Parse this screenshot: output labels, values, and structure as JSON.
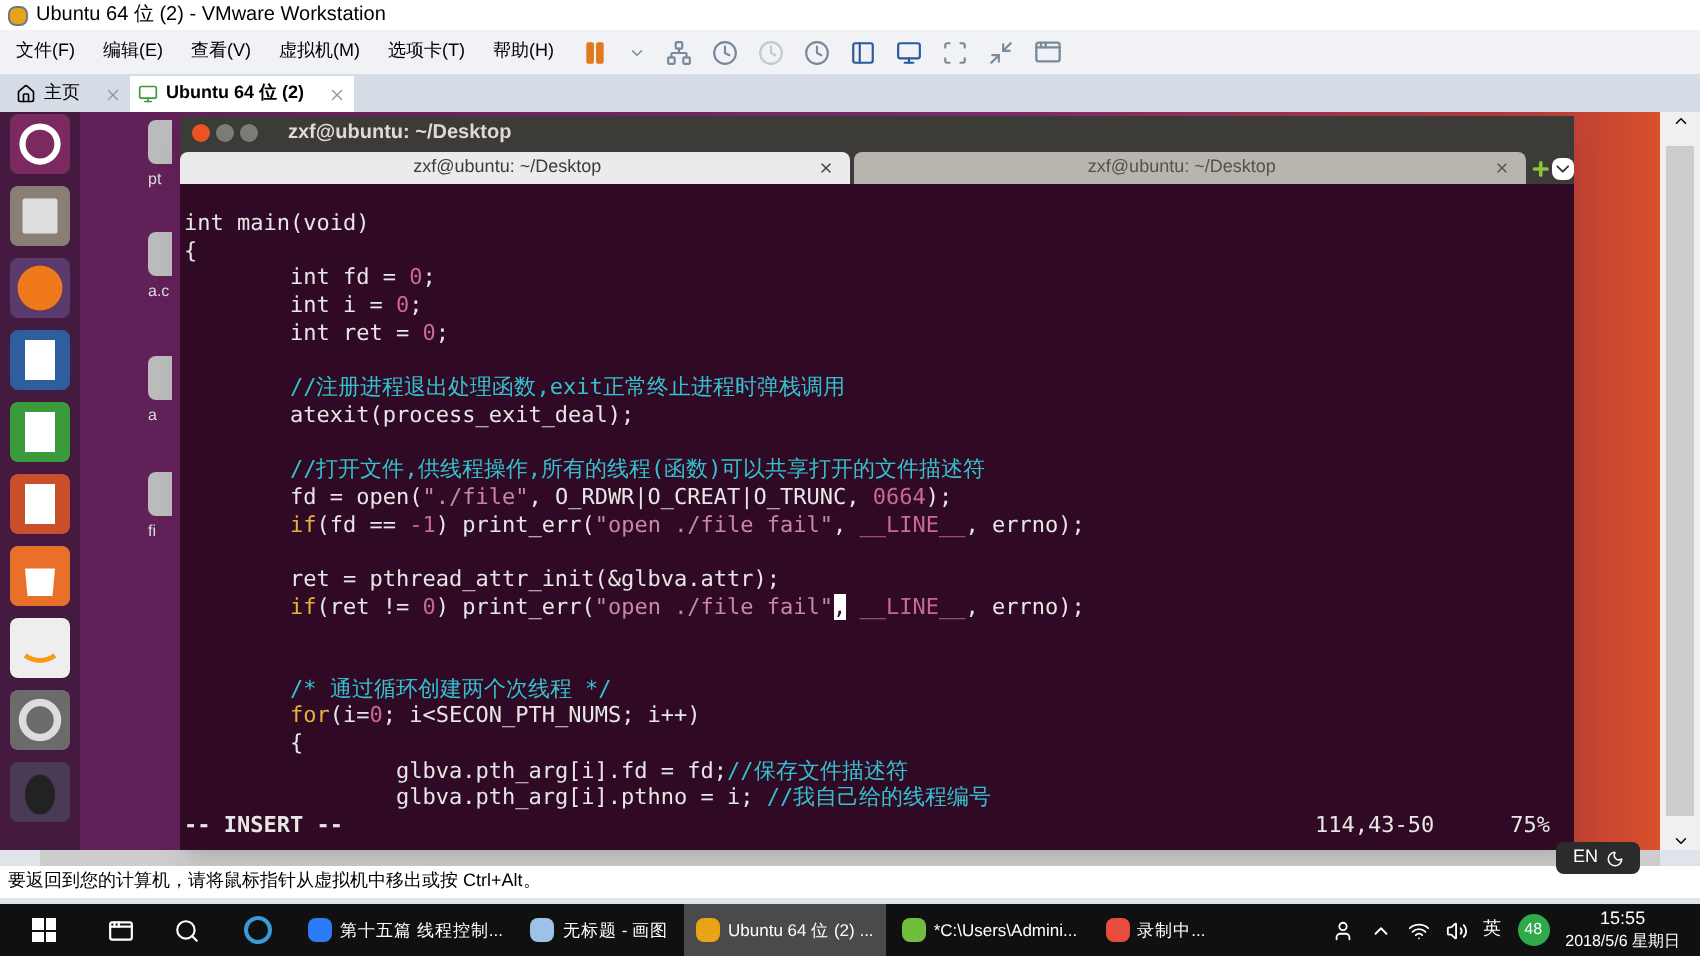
{
  "window": {
    "title": "Ubuntu 64 位 (2) - VMware Workstation"
  },
  "menu": [
    "文件(F)",
    "编辑(E)",
    "查看(V)",
    "虚拟机(M)",
    "选项卡(T)",
    "帮助(H)"
  ],
  "tabs": [
    {
      "label": "主页",
      "selected": false
    },
    {
      "label": "Ubuntu 64 位 (2)",
      "selected": true
    }
  ],
  "desktop_icons": [
    {
      "label": "pt"
    },
    {
      "label": "a.c"
    },
    {
      "label": "a"
    },
    {
      "label": "fi"
    }
  ],
  "terminal": {
    "title": "zxf@ubuntu: ~/Desktop",
    "tabs": [
      {
        "label": "zxf@ubuntu: ~/Desktop",
        "selected": true
      },
      {
        "label": "zxf@ubuntu: ~/Desktop",
        "selected": false
      }
    ],
    "lines": [
      {
        "kind": "code",
        "segments": [
          {
            "kind": "plain",
            "text": "int main(void)"
          }
        ]
      },
      {
        "kind": "code",
        "segments": [
          {
            "kind": "plain",
            "text": "{"
          }
        ]
      },
      {
        "kind": "code",
        "segments": [
          {
            "kind": "plain",
            "text": "\tint fd = "
          },
          {
            "kind": "number",
            "text": "0"
          },
          {
            "kind": "plain",
            "text": ";"
          }
        ]
      },
      {
        "kind": "code",
        "segments": [
          {
            "kind": "plain",
            "text": "\tint i = "
          },
          {
            "kind": "number",
            "text": "0"
          },
          {
            "kind": "plain",
            "text": ";"
          }
        ]
      },
      {
        "kind": "code",
        "segments": [
          {
            "kind": "plain",
            "text": "\tint ret = "
          },
          {
            "kind": "number",
            "text": "0"
          },
          {
            "kind": "plain",
            "text": ";"
          }
        ]
      },
      {
        "kind": "blank"
      },
      {
        "kind": "code",
        "segments": [
          {
            "kind": "comment",
            "text": "\t//注册进程退出处理函数,exit正常终止进程时弹栈调用"
          }
        ]
      },
      {
        "kind": "code",
        "segments": [
          {
            "kind": "plain",
            "text": "\tatexit(process_exit_deal);"
          }
        ]
      },
      {
        "kind": "blank"
      },
      {
        "kind": "code",
        "segments": [
          {
            "kind": "comment",
            "text": "\t//打开文件,供线程操作,所有的线程(函数)可以共享打开的文件描述符"
          }
        ]
      },
      {
        "kind": "code",
        "segments": [
          {
            "kind": "plain",
            "text": "\tfd = open("
          },
          {
            "kind": "string",
            "text": "\"./file\""
          },
          {
            "kind": "plain",
            "text": ", O_RDWR|O_CREAT|O_TRUNC, "
          },
          {
            "kind": "number",
            "text": "0664"
          },
          {
            "kind": "plain",
            "text": ");"
          }
        ]
      },
      {
        "kind": "code",
        "segments": [
          {
            "kind": "keyword",
            "text": "\tif"
          },
          {
            "kind": "plain",
            "text": "(fd == "
          },
          {
            "kind": "number",
            "text": "-1"
          },
          {
            "kind": "plain",
            "text": ") print_err("
          },
          {
            "kind": "string",
            "text": "\"open ./file fail\""
          },
          {
            "kind": "plain",
            "text": ", "
          },
          {
            "kind": "macro",
            "text": "__LINE__"
          },
          {
            "kind": "plain",
            "text": ", errno);"
          }
        ]
      },
      {
        "kind": "blank"
      },
      {
        "kind": "code",
        "segments": [
          {
            "kind": "plain",
            "text": "\tret = pthread_attr_init(&glbva.attr);"
          }
        ]
      },
      {
        "kind": "code",
        "segments": [
          {
            "kind": "keyword",
            "text": "\tif"
          },
          {
            "kind": "plain",
            "text": "(ret != "
          },
          {
            "kind": "number",
            "text": "0"
          },
          {
            "kind": "plain",
            "text": ") print_err("
          },
          {
            "kind": "string",
            "text": "\"open ./file fail\""
          },
          {
            "kind": "cursor",
            "text": ","
          },
          {
            "kind": "macro",
            "text": " __LINE__"
          },
          {
            "kind": "plain",
            "text": ", errno);"
          }
        ]
      },
      {
        "kind": "blank"
      },
      {
        "kind": "blank"
      },
      {
        "kind": "code",
        "segments": [
          {
            "kind": "comment",
            "text": "\t/* 通过循环创建两个次线程 */"
          }
        ]
      },
      {
        "kind": "code",
        "segments": [
          {
            "kind": "keyword",
            "text": "\tfor"
          },
          {
            "kind": "plain",
            "text": "(i="
          },
          {
            "kind": "number",
            "text": "0"
          },
          {
            "kind": "plain",
            "text": "; i<SECON_PTH_NUMS; i++)"
          }
        ]
      },
      {
        "kind": "code",
        "segments": [
          {
            "kind": "plain",
            "text": "\t{"
          }
        ]
      },
      {
        "kind": "code",
        "segments": [
          {
            "kind": "plain",
            "text": "\t\tglbva.pth_arg[i].fd = fd;"
          },
          {
            "kind": "comment",
            "text": "//保存文件描述符"
          }
        ]
      },
      {
        "kind": "code",
        "segments": [
          {
            "kind": "plain",
            "text": "\t\tglbva.pth_arg[i].pthno = i; "
          },
          {
            "kind": "comment",
            "text": "//我自己给的线程编号"
          }
        ]
      }
    ],
    "mode": "-- INSERT --",
    "position": "114,43-50",
    "scroll": "75%"
  },
  "status_bar": {
    "text": "要返回到您的计算机，请将鼠标指针从虚拟机中移出或按 Ctrl+Alt。"
  },
  "language_bar": {
    "label": "EN"
  },
  "taskbar": {
    "apps": [
      {
        "label": "第十五篇 线程控制...",
        "selected": false,
        "color": "#2b7cf6"
      },
      {
        "label": "无标题 - 画图",
        "selected": false,
        "color": "#9ec2e6"
      },
      {
        "label": "Ubuntu 64 位 (2) ...",
        "selected": true,
        "color": "#e8a317"
      },
      {
        "label": "*C:\\Users\\Admini...",
        "selected": false,
        "color": "#6fbf3c"
      },
      {
        "label": "录制中...",
        "selected": false,
        "color": "#e84c3d"
      }
    ],
    "ime": "英",
    "badge": "48",
    "time": "15:55",
    "date": "2018/5/6 星期日"
  }
}
